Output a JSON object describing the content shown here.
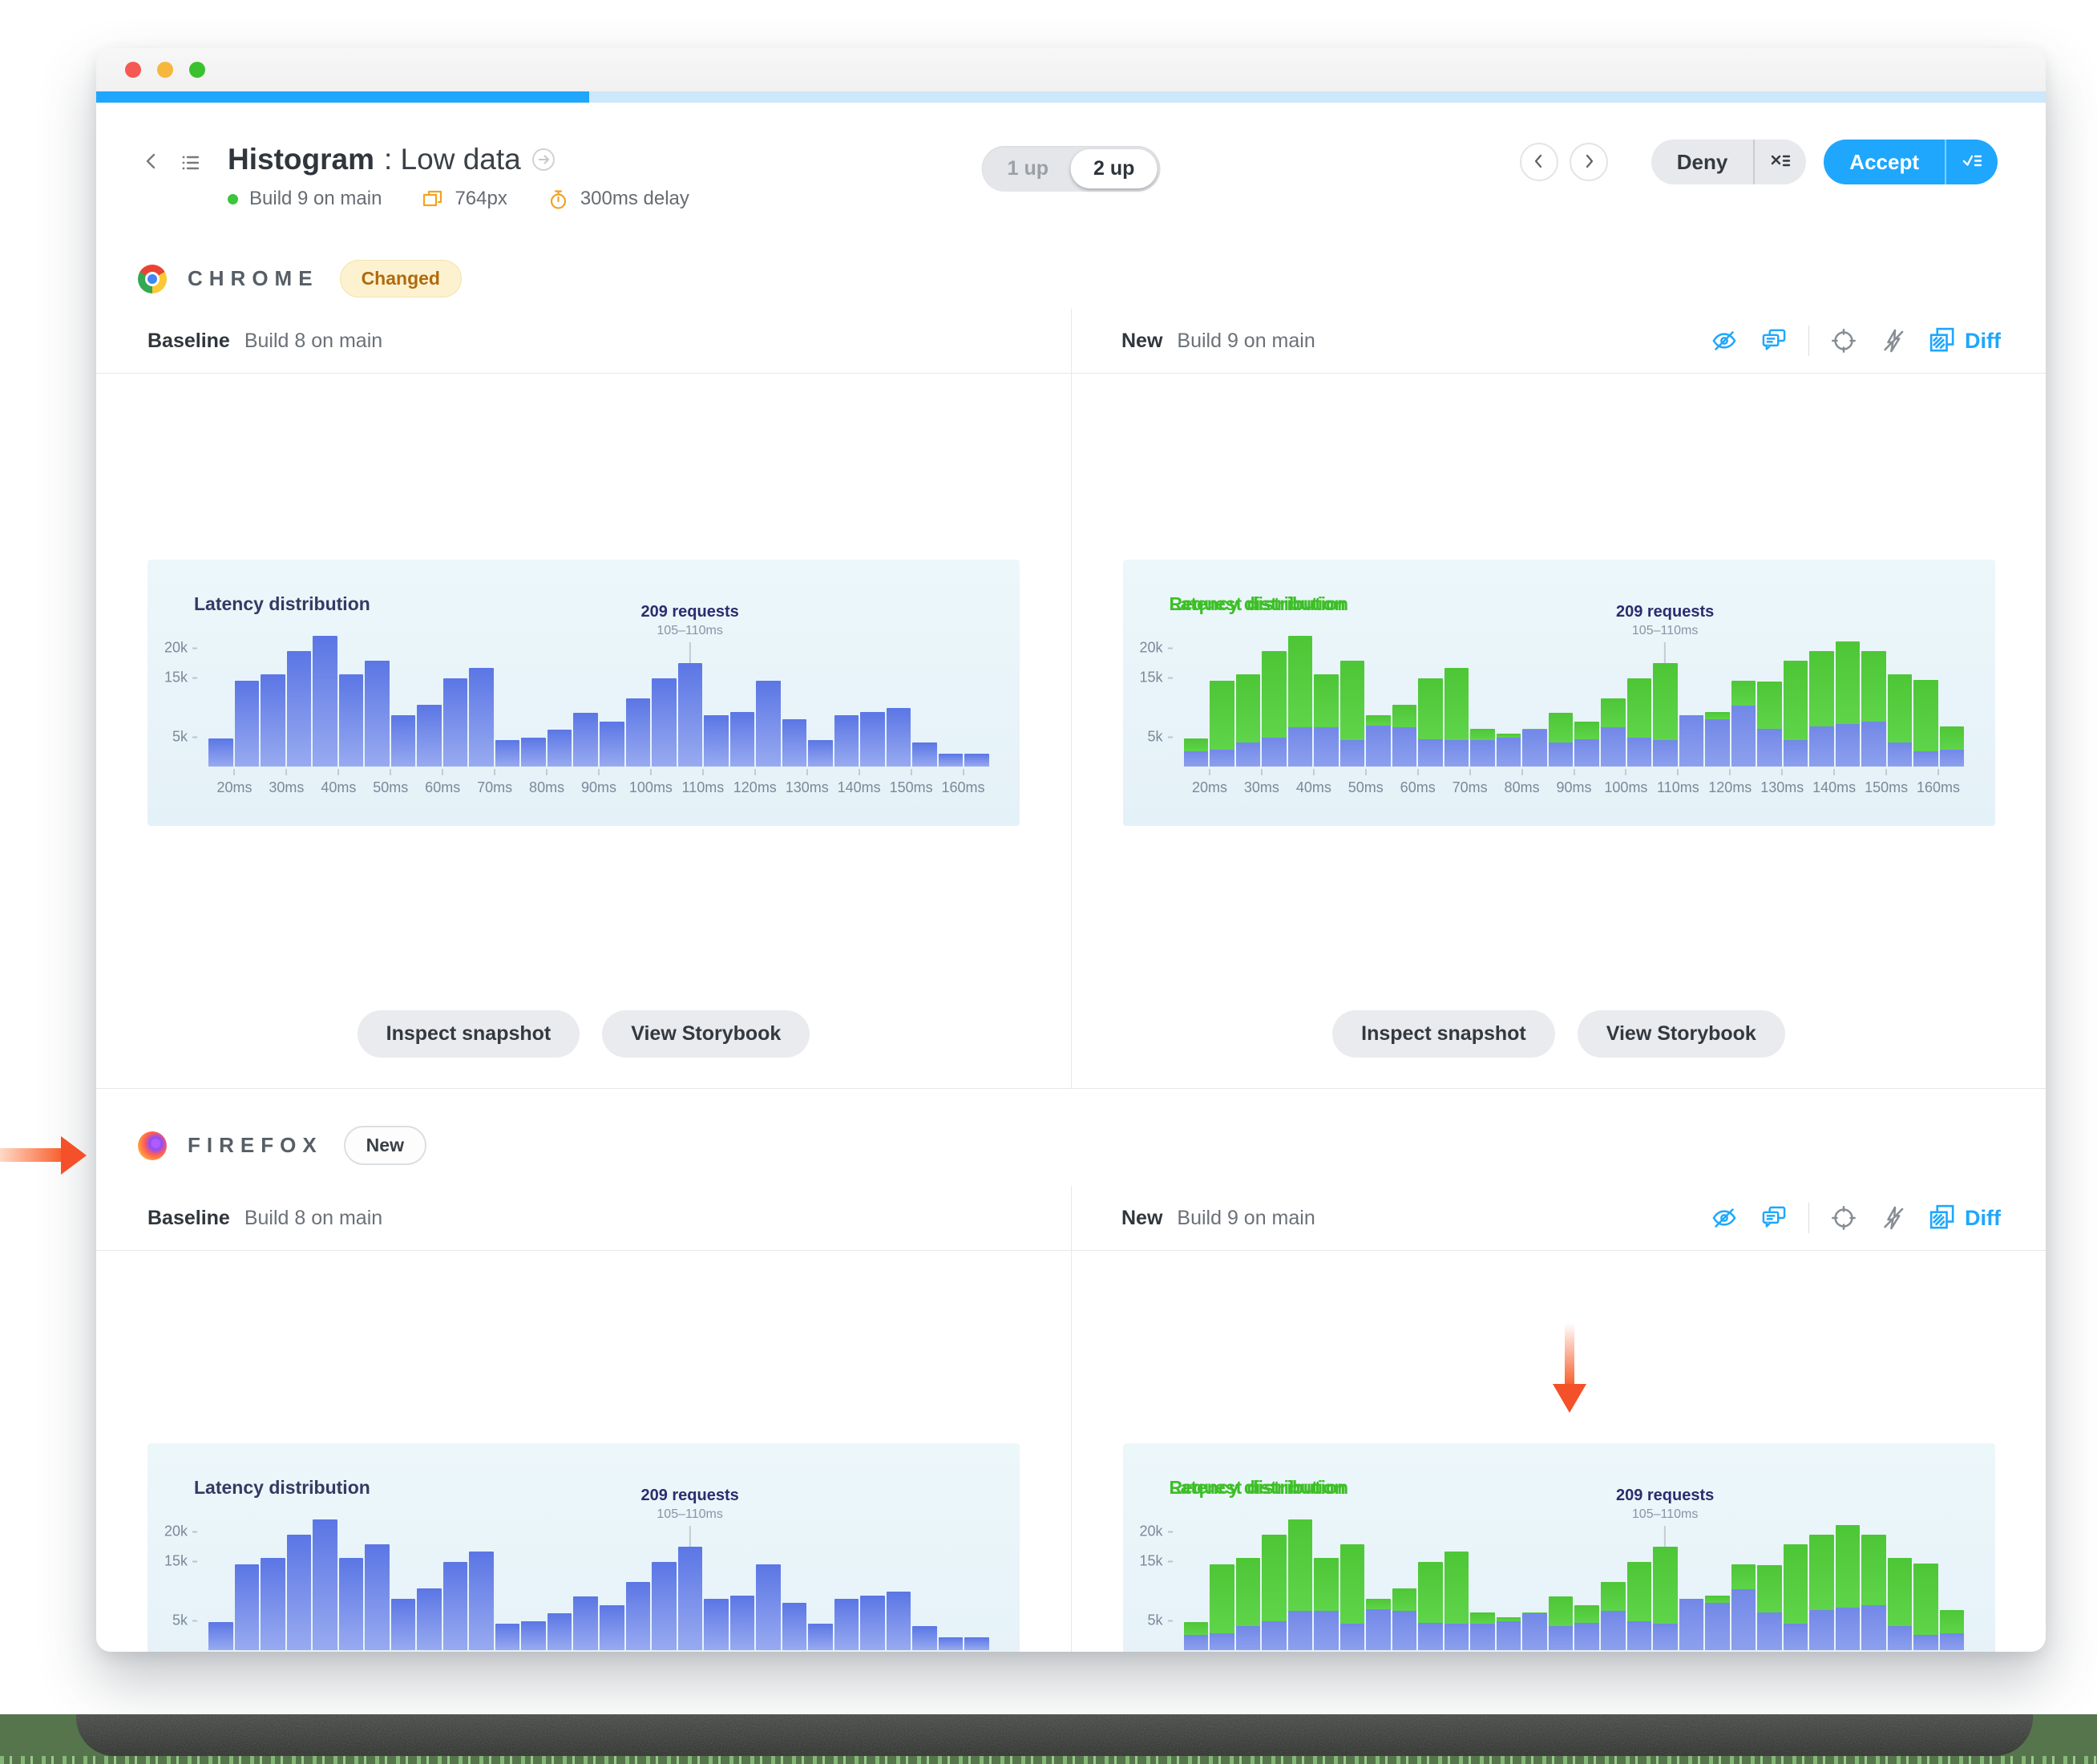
{
  "window": {
    "titlebar": {
      "traffic_lights": [
        "close",
        "minimize",
        "zoom"
      ]
    },
    "progress": {
      "percent_complete": 25
    },
    "header": {
      "title": "Histogram",
      "subtitle": ": Low data",
      "build_status": "Build 9 on main",
      "viewport": "764px",
      "delay": "300ms delay",
      "view_toggle": {
        "options": [
          "1 up",
          "2 up"
        ],
        "active": "2 up"
      },
      "deny_label": "Deny",
      "accept_label": "Accept"
    },
    "compare": {
      "baseline_label": "Baseline",
      "baseline_build": "Build 8 on main",
      "new_label": "New",
      "new_build": "Build 9 on main",
      "diff_label": "Diff"
    },
    "sections": [
      {
        "browser": "CHROME",
        "badge": "Changed"
      },
      {
        "browser": "FIREFOX",
        "badge": "New"
      }
    ],
    "snapshot_actions": {
      "inspect": "Inspect snapshot",
      "storybook": "View Storybook"
    }
  },
  "chart_data": [
    {
      "type": "bar",
      "role": "baseline-snapshot",
      "title": "Latency distribution",
      "x_bins_ms": {
        "start": 15,
        "width": 5,
        "count": 30
      },
      "x_tick_labels": [
        "20ms",
        "30ms",
        "40ms",
        "50ms",
        "60ms",
        "70ms",
        "80ms",
        "90ms",
        "100ms",
        "110ms",
        "120ms",
        "130ms",
        "140ms",
        "150ms",
        "160ms"
      ],
      "y_tick_labels": [
        "5k",
        "15k",
        "20k"
      ],
      "y_tick_values_k": [
        5,
        15,
        20
      ],
      "ylim_k": [
        0,
        24
      ],
      "values_k": [
        4.7,
        14.4,
        15.5,
        19.4,
        22,
        15.5,
        17.8,
        8.6,
        10.4,
        14.9,
        16.6,
        4.5,
        4.8,
        6.2,
        9.1,
        7.6,
        11.4,
        14.9,
        17.4,
        8.6,
        9.2,
        14.4,
        8,
        4.4,
        8.6,
        9.2,
        9.8,
        4.1,
        2.1,
        2.1
      ],
      "annotation": {
        "label": "209 requests",
        "sublabel": "105–110ms",
        "bar_index": 18
      }
    },
    {
      "type": "bar",
      "role": "diff-snapshot",
      "diff": true,
      "title": "Latency distribution",
      "title_overlay": "Request distribution",
      "x_bins_ms": {
        "start": 15,
        "width": 5,
        "count": 30
      },
      "x_tick_labels": [
        "20ms",
        "30ms",
        "40ms",
        "50ms",
        "60ms",
        "70ms",
        "80ms",
        "90ms",
        "100ms",
        "110ms",
        "120ms",
        "130ms",
        "140ms",
        "150ms",
        "160ms"
      ],
      "y_tick_labels": [
        "5k",
        "15k",
        "20k"
      ],
      "y_tick_values_k": [
        5,
        15,
        20
      ],
      "ylim_k": [
        0,
        24
      ],
      "unchanged_values_k": [
        2.6,
        2.9,
        4.1,
        4.8,
        6.6,
        6.6,
        4.4,
        6.9,
        6.6,
        4.6,
        4.5,
        4.5,
        4.9,
        6.2,
        4.1,
        4.6,
        6.6,
        4.8,
        4.5,
        8.6,
        8,
        10.3,
        6.3,
        4.5,
        6.7,
        7.2,
        7.5,
        4.1,
        2.6,
        2.9
      ],
      "changed_total_values_k": [
        4.7,
        14.4,
        15.5,
        19.4,
        22,
        15.5,
        17.8,
        8.6,
        10.4,
        14.9,
        16.6,
        6.4,
        5.5,
        6.4,
        9.1,
        7.6,
        11.4,
        14.9,
        17.4,
        8.6,
        9.2,
        14.4,
        14.3,
        17.8,
        19.4,
        21,
        19.4,
        15.5,
        14.5,
        6.7
      ],
      "annotation": {
        "label": "209 requests",
        "sublabel": "105–110ms",
        "bar_index": 18
      }
    }
  ],
  "icons": {
    "back": "chevron-left",
    "story_list": "list",
    "permalink": "arrow-right-circle",
    "build_status": "green-dot",
    "viewport": "stacked-viewports",
    "delay": "timer",
    "prev": "chevron-left-circle",
    "next": "chevron-right-circle",
    "deny": "x-with-list",
    "accept": "check-with-list",
    "hide_snapshot": "eye-off",
    "comment": "speech-bubbles",
    "focus": "crosshair",
    "interactions_off": "lightning-bolt-off",
    "diff": "overlapping-squares"
  },
  "colors": {
    "accent_blue": "#1ea7fd",
    "bar_blue_top": "#5b76e5",
    "bar_blue_bottom": "#98aaf0",
    "diff_green": "#4ec937",
    "diff_green_text": "#3dbf27",
    "diff_blue": "#7c91e9",
    "changed_badge_bg": "#fdf2cf",
    "changed_badge_text": "#b06a10",
    "chart_bg": "#e9f4f9",
    "annotation_arrow": "#f4512a"
  }
}
